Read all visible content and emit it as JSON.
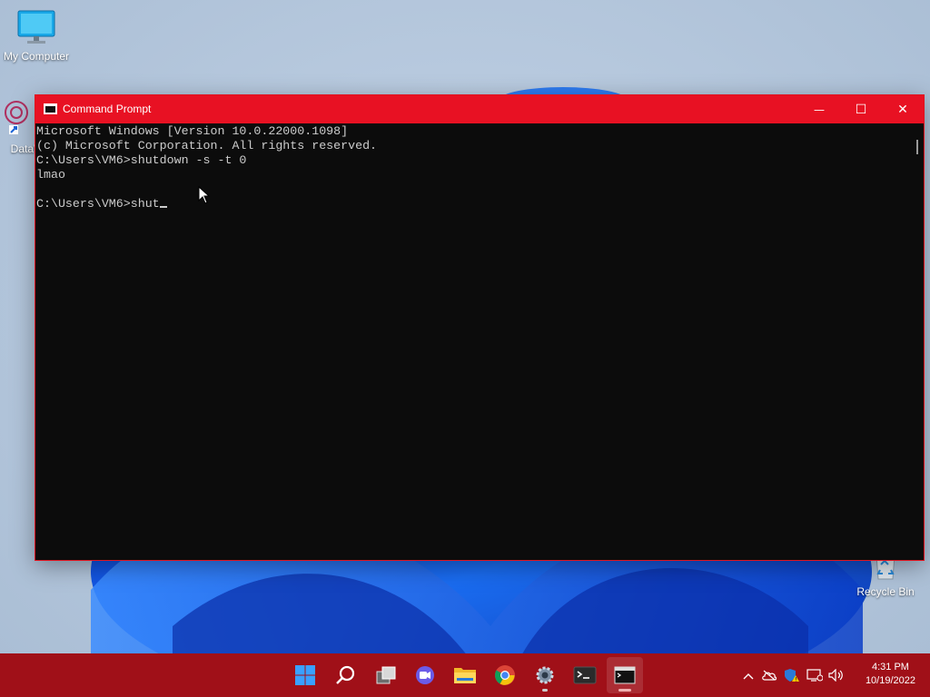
{
  "desktop": {
    "icons": [
      {
        "label": "My Computer"
      },
      {
        "label": "DataW"
      },
      {
        "label": "Recycle Bin"
      }
    ]
  },
  "window": {
    "title": "Command Prompt",
    "minimize": "—",
    "maximize": "☐",
    "close": "✕",
    "console_lines": [
      "Microsoft Windows [Version 10.0.22000.1098]",
      "(c) Microsoft Corporation. All rights reserved.",
      "C:\\Users\\VM6>shutdown -s -t 0",
      "lmao",
      "",
      "C:\\Users\\VM6>shut"
    ]
  },
  "taskbar": {
    "items": [
      "start",
      "search",
      "task-view",
      "chat",
      "file-explorer",
      "chrome",
      "settings",
      "terminal",
      "command-prompt"
    ],
    "clock_time": "4:31 PM",
    "clock_date": "10/19/2022"
  },
  "colors": {
    "titlebar": "#e81123",
    "taskbar": "#a01018",
    "console_bg": "#0c0c0c",
    "console_fg": "#cccccc"
  }
}
